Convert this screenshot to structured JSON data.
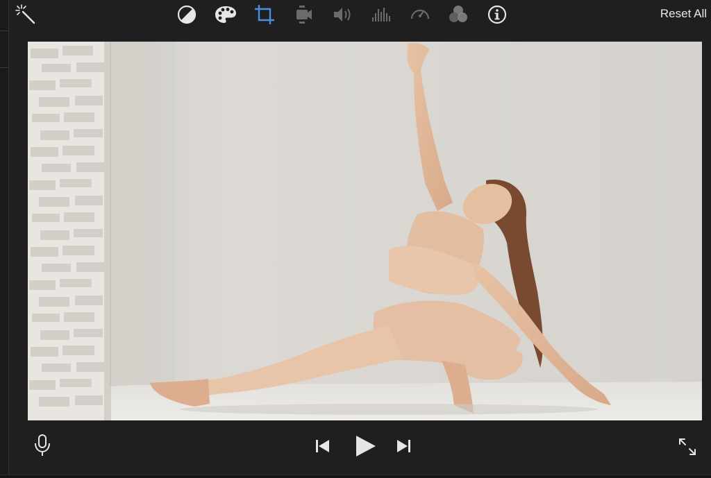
{
  "toolbar": {
    "tools": [
      {
        "name": "enhance",
        "icon": "magic-wand-icon"
      },
      {
        "name": "color-balance",
        "icon": "color-balance-icon"
      },
      {
        "name": "color-correction",
        "icon": "palette-icon"
      },
      {
        "name": "cropping",
        "icon": "crop-icon",
        "active": true
      },
      {
        "name": "stabilization",
        "icon": "video-camera-icon"
      },
      {
        "name": "volume",
        "icon": "speaker-icon"
      },
      {
        "name": "noise-reduction",
        "icon": "equalizer-icon"
      },
      {
        "name": "speed",
        "icon": "speedometer-icon"
      },
      {
        "name": "clip-filter",
        "icon": "filter-circles-icon"
      },
      {
        "name": "info",
        "icon": "info-icon"
      }
    ],
    "reset_label": "Reset All"
  },
  "viewer": {
    "content": "photo-yoga-side-lunge"
  },
  "transport": {
    "record": "microphone-icon",
    "previous": "skip-back-icon",
    "play": "play-icon",
    "next": "skip-forward-icon",
    "fullscreen": "fullscreen-icon"
  },
  "colors": {
    "background": "#1f1f1f",
    "icon_enabled": "#e6e6e6",
    "icon_disabled": "#6b6b6b",
    "accent": "#4a90e2"
  }
}
